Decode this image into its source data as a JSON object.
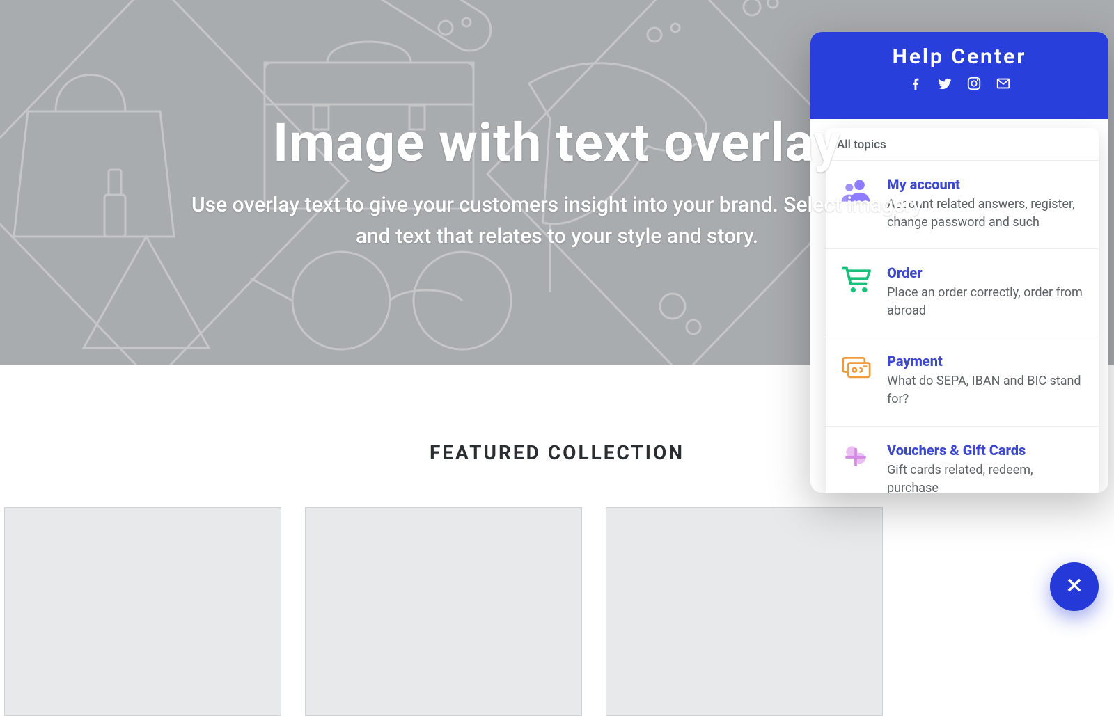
{
  "hero": {
    "title": "Image with text overlay",
    "subtitle": "Use overlay text to give your customers insight into your brand. Select imagery and text that relates to your style and story."
  },
  "featured": {
    "heading": "FEATURED COLLECTION"
  },
  "helpCenter": {
    "title": "Help Center",
    "breadcrumb": "All topics",
    "topics": [
      {
        "icon": "people-icon",
        "title": "My account",
        "desc": "Account related answers, register, change password and such"
      },
      {
        "icon": "cart-icon",
        "title": "Order",
        "desc": "Place an order correctly, order from abroad"
      },
      {
        "icon": "credit-card-icon",
        "title": "Payment",
        "desc": "What do SEPA, IBAN and BIC stand for?"
      },
      {
        "icon": "gift-icon",
        "title": "Vouchers & Gift Cards",
        "desc": "Gift cards related, redeem, purchase"
      }
    ],
    "social": [
      "facebook-icon",
      "twitter-icon",
      "instagram-icon",
      "mail-icon"
    ]
  }
}
